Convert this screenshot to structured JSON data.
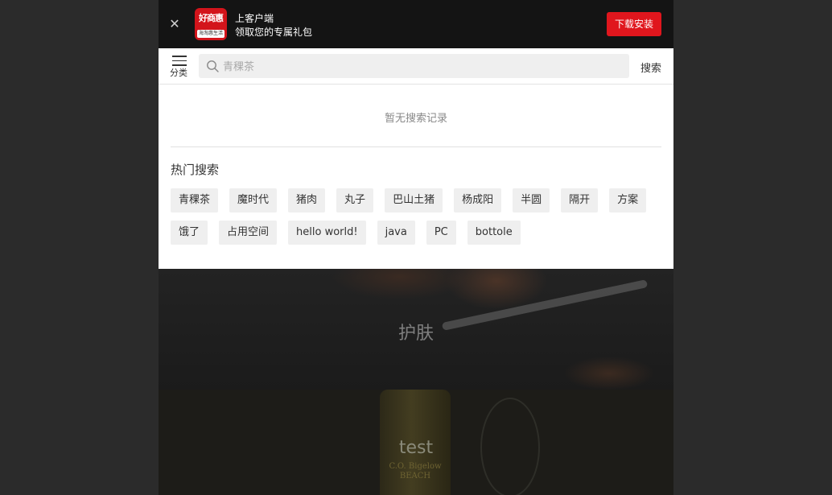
{
  "banner": {
    "close_icon": "close-icon",
    "logo_text": "好商惠",
    "logo_subtext": "海淘惠生活",
    "line1": "上客户端",
    "line2": "领取您的专属礼包",
    "download_label": "下载安装",
    "accent_color": "#e0161d"
  },
  "search": {
    "category_label": "分类",
    "placeholder": "青稞茶",
    "value": "",
    "button_label": "搜索"
  },
  "history": {
    "empty_text": "暂无搜索记录"
  },
  "hot": {
    "title": "热门搜索",
    "tags": [
      "青稞茶",
      "魔时代",
      "猪肉",
      "丸子",
      "巴山土猪",
      "杨成阳",
      "半圆",
      "隔开",
      "方案",
      "饿了",
      "占用空间",
      "hello world!",
      "java",
      "PC",
      "bottole"
    ]
  },
  "content": {
    "card1_title": "护肤",
    "card2_title": "test",
    "bottle_text": "C.O. Bigelow BEACH"
  }
}
